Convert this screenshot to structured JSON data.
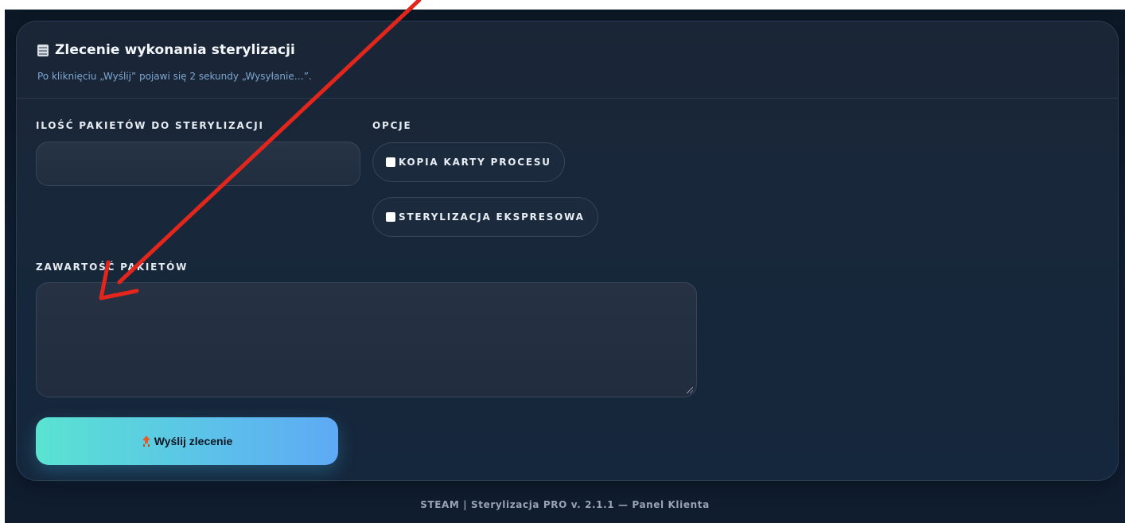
{
  "card": {
    "title": "Zlecenie wykonania sterylizacji",
    "subtitle": "Po kliknięciu „Wyślij” pojawi się 2 sekundy „Wysyłanie…”."
  },
  "form": {
    "quantity": {
      "label": "ILOŚĆ PAKIETÓW DO STERYLIZACJI",
      "value": "",
      "placeholder": ""
    },
    "options": {
      "label": "OPCJE",
      "items": [
        {
          "label": "KOPIA KARTY PROCESU",
          "checked": false
        },
        {
          "label": "STERYLIZACJA EKSPRESOWA",
          "checked": false
        }
      ]
    },
    "contents": {
      "label": "ZAWARTOŚĆ PAKIETÓW",
      "value": "",
      "placeholder": ""
    },
    "submit_label": "Wyślij zlecenie"
  },
  "footer": {
    "text": "STEAM | Sterylizacja PRO v. 2.1.1 — Panel Klienta"
  },
  "icons": {
    "title_icon": "document-icon",
    "submit_icon": "upload-icon"
  },
  "colors": {
    "accent_start": "#5ae3d1",
    "accent_end": "#5ea9f5",
    "annotation_arrow": "#e3261c"
  }
}
